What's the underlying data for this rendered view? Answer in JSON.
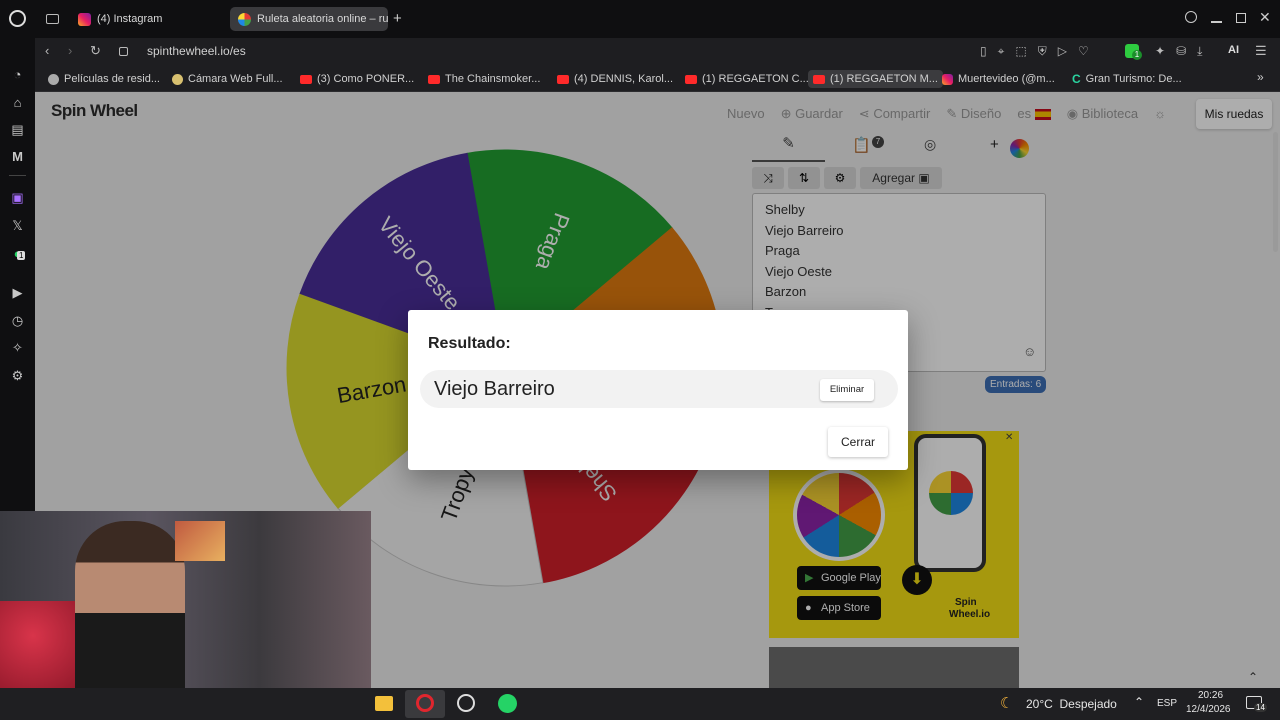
{
  "browser": {
    "tabs": [
      {
        "label": "(4) Instagram",
        "active": false
      },
      {
        "label": "Ruleta aleatoria online – ru",
        "active": true
      }
    ],
    "new_tab_symbol": "+",
    "url": "spinthewheel.io/es",
    "ai_label": "AI",
    "badge_count": "1",
    "bookmarks": [
      {
        "label": "Películas de resid...",
        "icon": "film-icon"
      },
      {
        "label": "Cámara Web Full...",
        "icon": "camera-icon"
      },
      {
        "label": "(3) Como PONER...",
        "icon": "youtube-icon"
      },
      {
        "label": "The Chainsmoker...",
        "icon": "youtube-icon"
      },
      {
        "label": "(4) DENNIS, Karol...",
        "icon": "youtube-icon"
      },
      {
        "label": "(1) REGGAETON C...",
        "icon": "youtube-icon"
      },
      {
        "label": "(1) REGGAETON M...",
        "icon": "youtube-icon"
      },
      {
        "label": "Muertevideo (@m...",
        "icon": "instagram-icon"
      },
      {
        "label": "Gran Turismo: De...",
        "icon": "c-icon"
      }
    ],
    "sidebar_badge": "1"
  },
  "site": {
    "logo": "Spin Wheel",
    "nav": {
      "new": "Nuevo",
      "save": "Guardar",
      "share": "Compartir",
      "design": "Diseño",
      "lang": "es",
      "library": "Biblioteca",
      "my_wheels": "Mis ruedas"
    },
    "panel": {
      "notif_count": "7",
      "add_label": "Agregar",
      "entries": [
        "Shelby",
        "Viejo Barreiro",
        "Praga",
        "Viejo Oeste",
        "Barzon",
        "Tropy"
      ],
      "entries_count": "Entradas: 6"
    },
    "wheel": {
      "segments": [
        {
          "label": "Praga",
          "color": "#22a033"
        },
        {
          "label": "Viejo Barreiro",
          "color": "#e07b10"
        },
        {
          "label": "Shelby",
          "color": "#d21f2a"
        },
        {
          "label": "Tropy",
          "color": "#f4f4f4"
        },
        {
          "label": "Barzon",
          "color": "#dcdc30"
        },
        {
          "label": "Viejo Oeste",
          "color": "#4a2f9a"
        }
      ]
    },
    "ad": {
      "google_play": "Google Play",
      "app_store": "App Store",
      "brand_1": "Spin",
      "brand_2": "Wheel.io"
    }
  },
  "modal": {
    "title": "Resultado:",
    "result": "Viejo Barreiro",
    "remove_label": "Eliminar",
    "close_label": "Cerrar"
  },
  "taskbar": {
    "weather": "20°C  Despejado",
    "lang": "ESP",
    "time": "20:26",
    "date": "12/4/2026",
    "notifications": "14"
  }
}
